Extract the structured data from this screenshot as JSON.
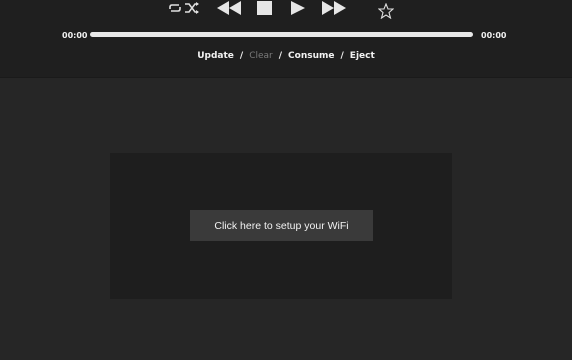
{
  "player": {
    "time_elapsed": "00:00",
    "time_total": "00:00",
    "progress": 1.0,
    "icons": [
      "repeat-icon",
      "shuffle-icon",
      "previous-icon",
      "stop-icon",
      "play-icon",
      "next-icon",
      "star-icon"
    ]
  },
  "actions": {
    "update": "Update",
    "clear": "Clear",
    "consume": "Consume",
    "eject": "Eject",
    "separator": "/"
  },
  "main": {
    "wifi_button": "Click here to setup your WiFi"
  },
  "colors": {
    "background": "#262626",
    "topbar": "#1f1f1f",
    "panel": "#1e1e1e",
    "button": "#3a3a3a",
    "muted_text": "#7a7a7a"
  }
}
